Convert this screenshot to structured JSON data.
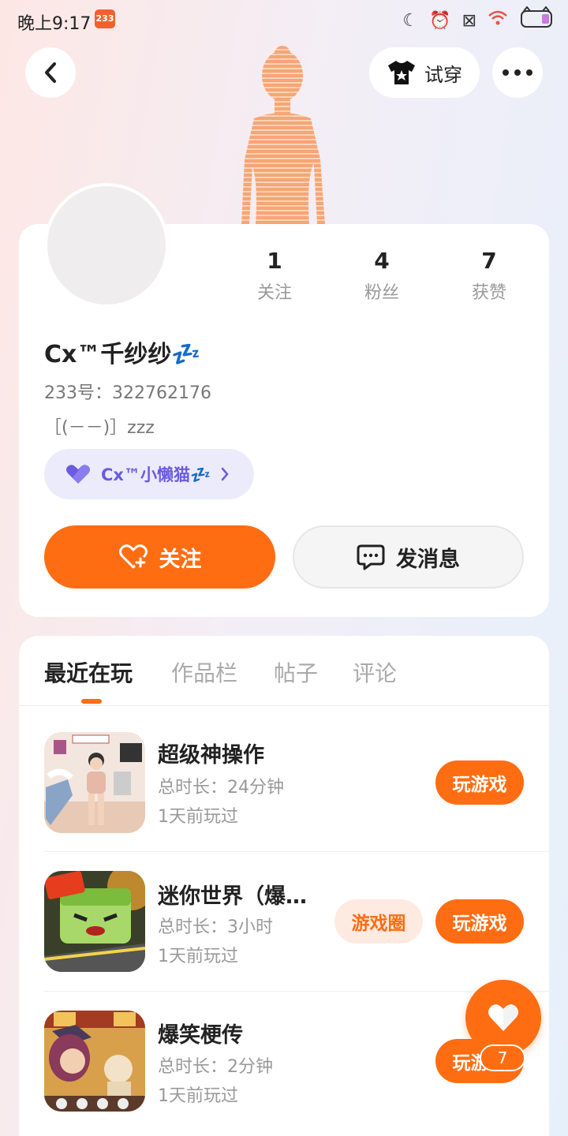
{
  "status_bar": {
    "time": "晚上9:17",
    "app_badge": "233",
    "icons": [
      "moon-icon",
      "alarm-icon",
      "close-box-icon",
      "wifi-icon",
      "battery-icon"
    ]
  },
  "header": {
    "try_on_label": "试穿"
  },
  "profile": {
    "stats": [
      {
        "value": "1",
        "label": "关注"
      },
      {
        "value": "4",
        "label": "粉丝"
      },
      {
        "value": "7",
        "label": "获赞"
      }
    ],
    "name": "Cx™千纱纱💤",
    "id_text": "233号：322762176",
    "bio": "［(－－)］zzz",
    "group_label": "Cx™小懒猫💤",
    "follow_label": "关注",
    "message_label": "发消息"
  },
  "tabs": [
    {
      "label": "最近在玩",
      "active": true
    },
    {
      "label": "作品栏",
      "active": false
    },
    {
      "label": "帖子",
      "active": false
    },
    {
      "label": "评论",
      "active": false
    }
  ],
  "games": [
    {
      "title": "超级神操作",
      "duration": "总时长：24分钟",
      "last_played": "1天前玩过",
      "play_label": "玩游戏",
      "circle_label": ""
    },
    {
      "title": "迷你世界（爆…",
      "duration": "总时长：3小时",
      "last_played": "1天前玩过",
      "play_label": "玩游戏",
      "circle_label": "游戏圈"
    },
    {
      "title": "爆笑梗传",
      "duration": "总时长：2分钟",
      "last_played": "1天前玩过",
      "play_label": "玩游戏",
      "circle_label": ""
    }
  ],
  "like_fab": {
    "count": "7"
  },
  "colors": {
    "accent": "#ff6d12",
    "group_text": "#6b5be0",
    "group_bg": "#ecebfb"
  }
}
